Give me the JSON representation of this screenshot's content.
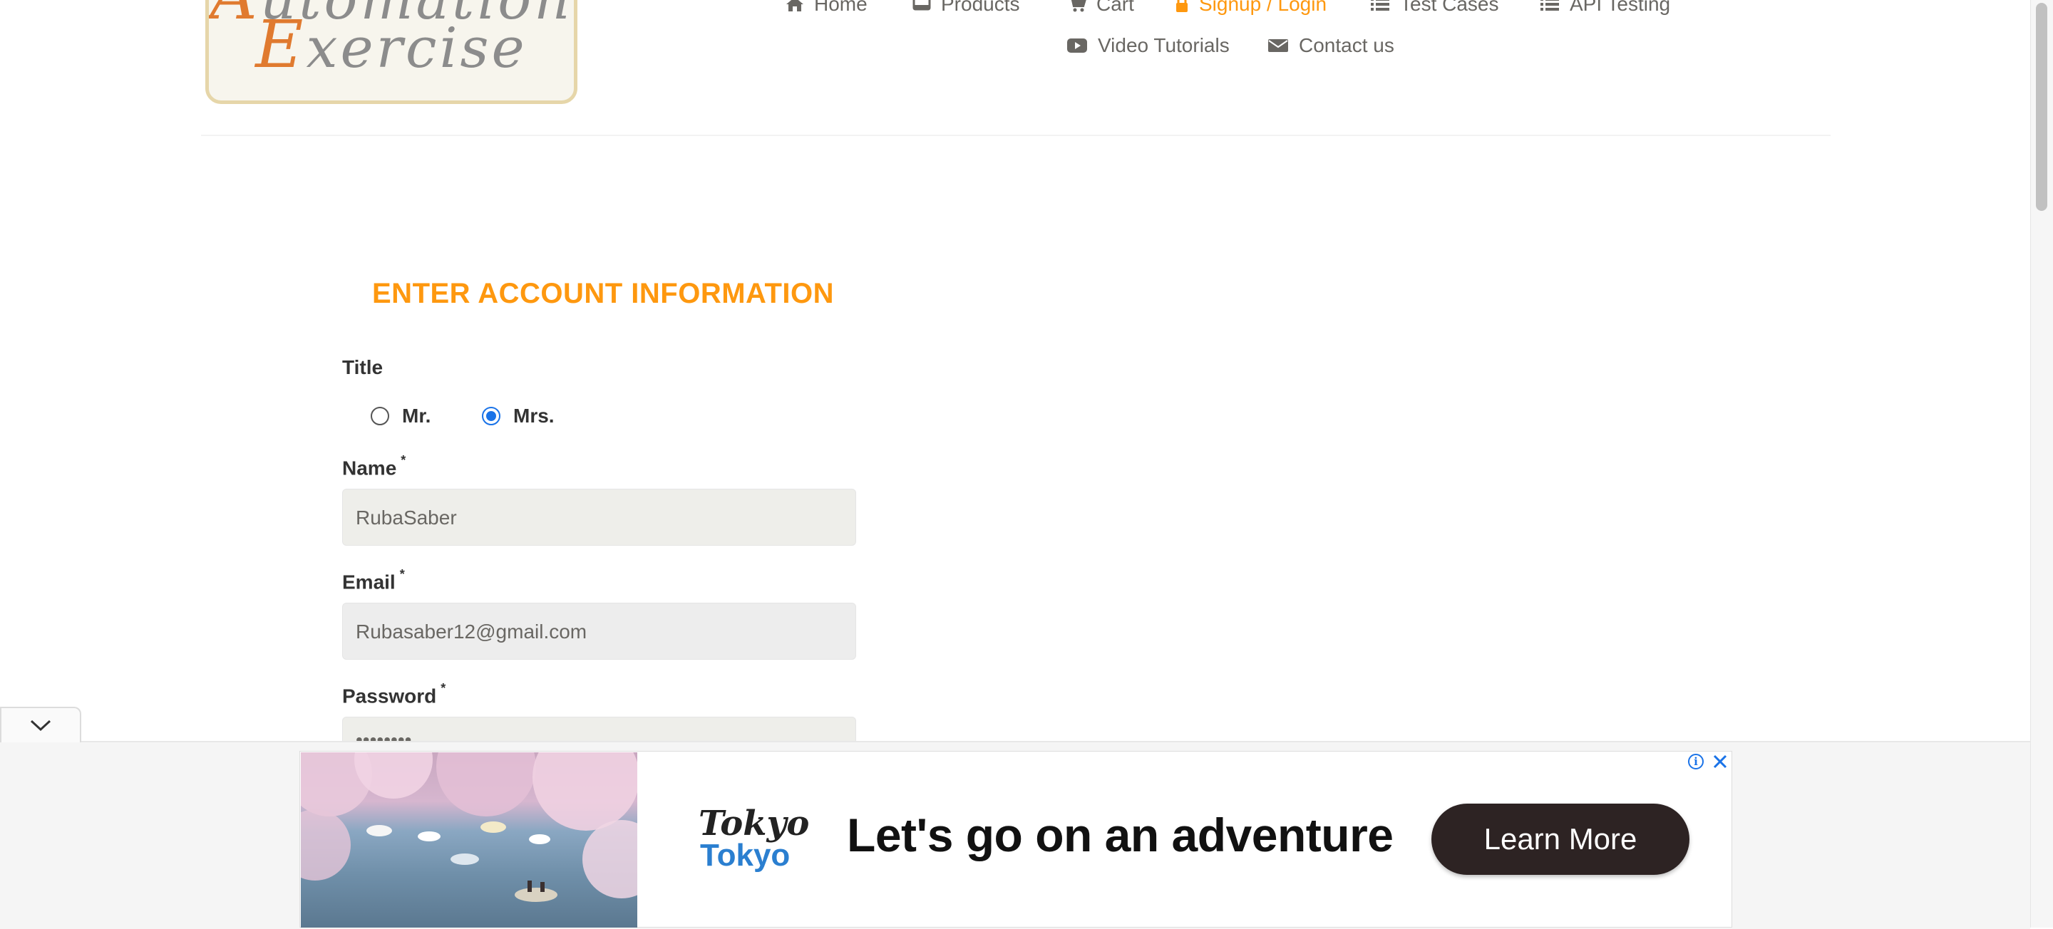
{
  "logo": {
    "line1": "Automation",
    "line2": "Exercise"
  },
  "nav": {
    "items": [
      {
        "label": "Home",
        "icon": "home-icon"
      },
      {
        "label": "Products",
        "icon": "products-icon"
      },
      {
        "label": "Cart",
        "icon": "cart-icon"
      },
      {
        "label": "Signup / Login",
        "icon": "lock-icon",
        "active": true
      },
      {
        "label": "Test Cases",
        "icon": "list-icon"
      },
      {
        "label": "API Testing",
        "icon": "list-icon"
      },
      {
        "label": "Video Tutorials",
        "icon": "youtube-icon"
      },
      {
        "label": "Contact us",
        "icon": "envelope-icon"
      }
    ]
  },
  "form": {
    "heading": "ENTER ACCOUNT INFORMATION",
    "title_label": "Title",
    "title_options": [
      {
        "label": "Mr.",
        "checked": false
      },
      {
        "label": "Mrs.",
        "checked": true
      }
    ],
    "name_label": "Name",
    "name_value": "RubaSaber",
    "email_label": "Email",
    "email_value": "Rubasaber12@gmail.com",
    "password_label": "Password",
    "password_value": "••••••••",
    "required_mark": "*"
  },
  "ad": {
    "brand_line1": "Tokyo",
    "brand_line2": "Tokyo",
    "headline": "Let's go on an adventure",
    "cta": "Learn More",
    "info_glyph": "i"
  },
  "colors": {
    "accent": "#fe980f",
    "text": "#696763",
    "radio_checked": "#1a73e8",
    "cta_bg": "#2d2323"
  }
}
